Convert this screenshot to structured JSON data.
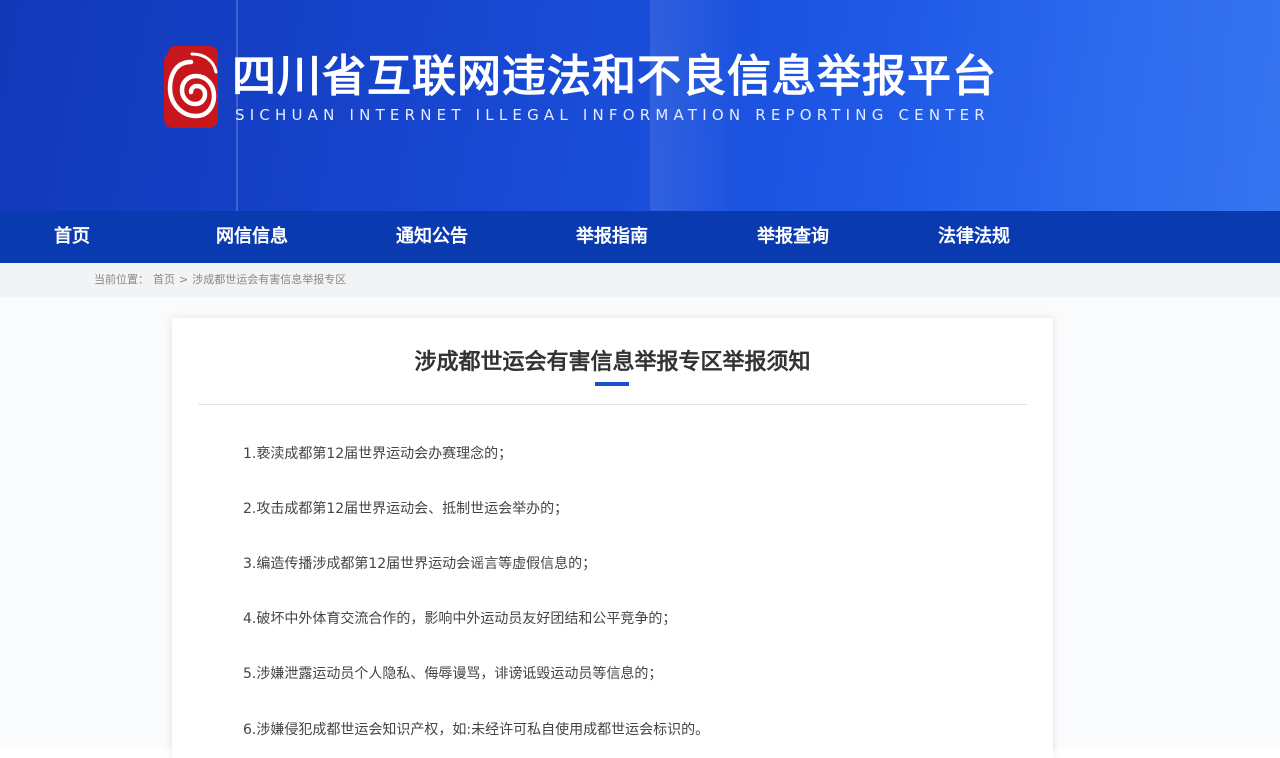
{
  "header": {
    "title": "四川省互联网违法和不良信息举报平台",
    "subtitle": "SICHUAN INTERNET ILLEGAL INFORMATION REPORTING CENTER",
    "logo_icon": "spiral-seal-icon",
    "colors": {
      "banner": "#1746cf",
      "nav": "#0a3ab0",
      "logo_red": "#c8161d",
      "accent": "#1a4fcf"
    }
  },
  "nav": {
    "items": [
      {
        "label": "首页"
      },
      {
        "label": "网信信息"
      },
      {
        "label": "通知公告"
      },
      {
        "label": "举报指南"
      },
      {
        "label": "举报查询"
      },
      {
        "label": "法律法规"
      }
    ]
  },
  "breadcrumb": {
    "label": "当前位置：",
    "home": "首页",
    "separator": ">",
    "current": "涉成都世运会有害信息举报专区"
  },
  "article": {
    "title": "涉成都世运会有害信息举报专区举报须知",
    "rules": [
      "1.亵渎成都第12届世界运动会办赛理念的；",
      "2.攻击成都第12届世界运动会、抵制世运会举办的；",
      "3.编造传播涉成都第12届世界运动会谣言等虚假信息的；",
      "4.破坏中外体育交流合作的，影响中外运动员友好团结和公平竞争的；",
      "5.涉嫌泄露运动员个人隐私、侮辱谩骂，诽谤诋毁运动员等信息的；",
      "6.涉嫌侵犯成都世运会知识产权，如:未经许可私自使用成都世运会标识的。"
    ]
  }
}
